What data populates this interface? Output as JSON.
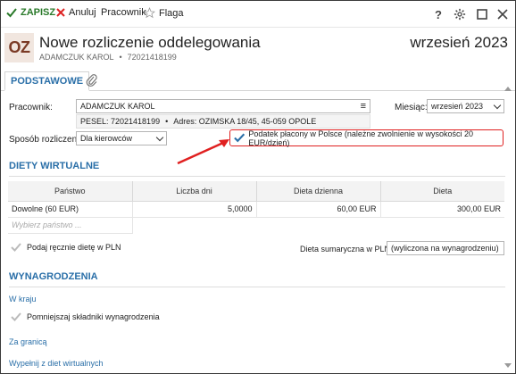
{
  "toolbar": {
    "save": "ZAPISZ",
    "cancel": "Anuluj",
    "employee": "Pracownik",
    "flag": "Flaga"
  },
  "header": {
    "badge": "OZ",
    "title": "Nowe rozliczenie oddelegowania",
    "person": "ADAMCZUK KAROL",
    "pesel_short": "72021418199",
    "month": "wrzesień 2023"
  },
  "tabs": {
    "main": "PODSTAWOWE"
  },
  "form": {
    "employee_label": "Pracownik:",
    "employee_value": "ADAMCZUK KAROL",
    "info_pesel": "PESEL: 72021418199",
    "info_address": "Adres: OZIMSKA 18/45, 45-059 OPOLE",
    "month_label": "Miesiąc:",
    "month_value": "wrzesień 2023",
    "method_label": "Sposób rozliczenia:",
    "method_value": "Dla kierowców",
    "tax_label": "Podatek płacony w Polsce (należne zwolnienie w wysokości 20 EUR/dzień)"
  },
  "diets": {
    "section_title": "DIETY WIRTUALNE",
    "columns": [
      "Państwo",
      "Liczba dni",
      "Dieta dzienna",
      "Dieta"
    ],
    "rows": [
      {
        "country": "Dowolne (60 EUR)",
        "days": "5,0000",
        "daily": "60,00 EUR",
        "total": "300,00 EUR"
      }
    ],
    "country_placeholder": "Wybierz państwo ...",
    "manual_label": "Podaj ręcznie dietę w PLN",
    "sum_label": "Dieta sumaryczna w PLN:",
    "sum_value": "(wyliczona na wynagrodzeniu)"
  },
  "salary": {
    "section_title": "WYNAGRODZENIA",
    "domestic_link": "W kraju",
    "reduce_label": "Pomniejszaj składniki wynagrodzenia",
    "abroad_link": "Za granicą",
    "fill_link": "Wypełnij z diet wirtualnych"
  },
  "colors": {
    "accent": "#2a6fa8",
    "save_green": "#2a7a2a",
    "highlight_red": "#e02020"
  }
}
